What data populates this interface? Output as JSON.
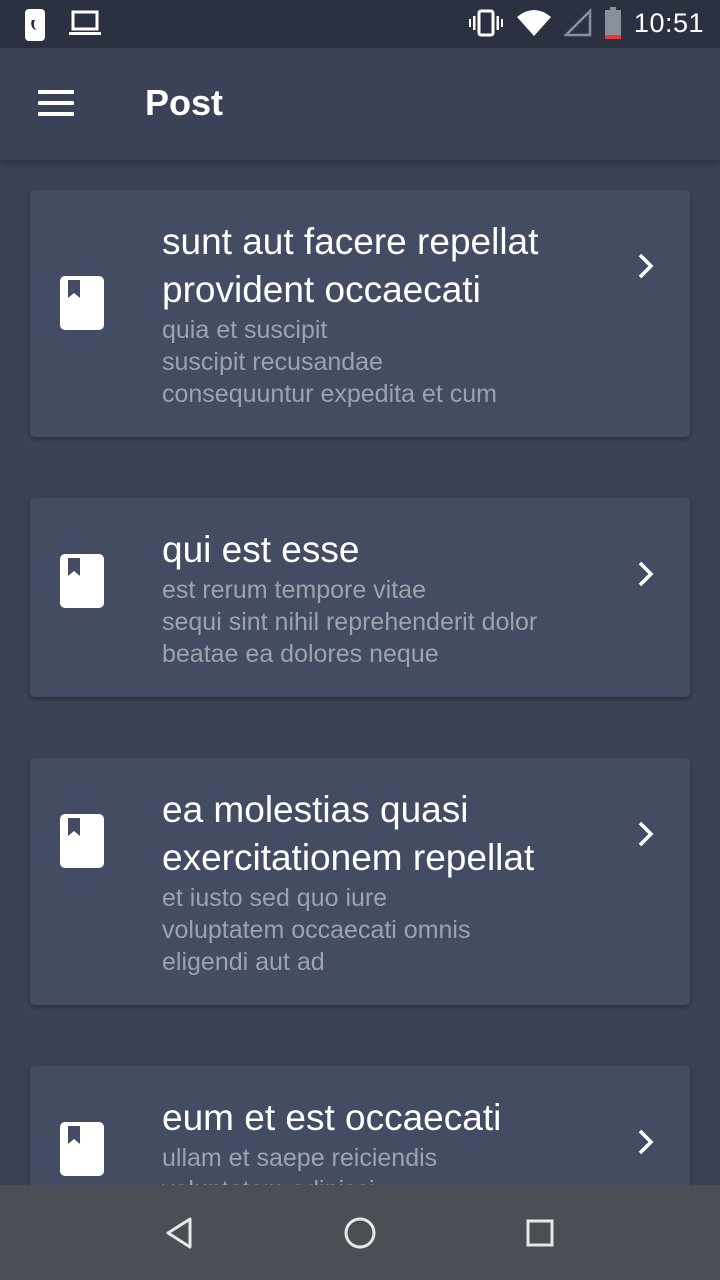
{
  "status_bar": {
    "time": "10:51",
    "icons": [
      "phone-wallpaper-icon",
      "laptop-icon",
      "vibrate-icon",
      "wifi-icon",
      "signal-icon",
      "battery-icon"
    ]
  },
  "app_bar": {
    "title": "Post",
    "menu_icon": "hamburger-menu-icon"
  },
  "posts": [
    {
      "title": "sunt aut facere repellat provident occaecati",
      "body": "quia et suscipit\nsuscipit recusandae\nconsequuntur expedita et cum"
    },
    {
      "title": "qui est esse",
      "body": "est rerum tempore vitae\nsequi sint nihil reprehenderit dolor\nbeatae ea dolores neque"
    },
    {
      "title": "ea molestias quasi exercitationem repellat",
      "body": "et iusto sed quo iure\nvoluptatem occaecati omnis\neligendi aut ad"
    },
    {
      "title": "eum et est occaecati",
      "body": "ullam et saepe reiciendis\nvoluptatem adipisci"
    }
  ],
  "nav_bar": {
    "icons": [
      "back-icon",
      "home-icon",
      "recents-icon"
    ]
  },
  "colors": {
    "background": "#3b4257",
    "card": "#444c63",
    "status_bar": "#2c3141",
    "nav_bar": "#4a4f56",
    "title_text": "#ffffff",
    "body_text": "#9ca2b0"
  }
}
